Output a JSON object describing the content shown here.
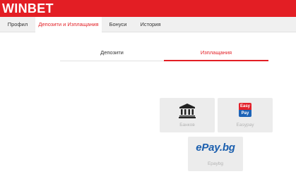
{
  "brand": {
    "logo_text": "WINBET",
    "accent": "#e31e24"
  },
  "nav": {
    "items": [
      {
        "label": "Профил"
      },
      {
        "label": "Депозити и Изплащания"
      },
      {
        "label": "Бонуси"
      },
      {
        "label": "История"
      }
    ],
    "active_index": 1
  },
  "subtabs": {
    "items": [
      {
        "label": "Депозити"
      },
      {
        "label": "Изплащания"
      }
    ],
    "active_index": 1
  },
  "methods": [
    {
      "label": "Банков",
      "icon": "bank-icon"
    },
    {
      "label": "Easypay",
      "icon": "easypay-icon",
      "icon_text_top": "Easy",
      "icon_text_bottom": "Pay"
    },
    {
      "label": "Epaybg",
      "icon": "epay-logo",
      "logo_text": "ePay.bg"
    }
  ],
  "colors": {
    "tile_bg": "#ececec",
    "tile_label": "#b3b3b3",
    "epay_blue": "#1b5fae",
    "easypay_red": "#e3202a",
    "easypay_blue": "#1d63b7"
  }
}
